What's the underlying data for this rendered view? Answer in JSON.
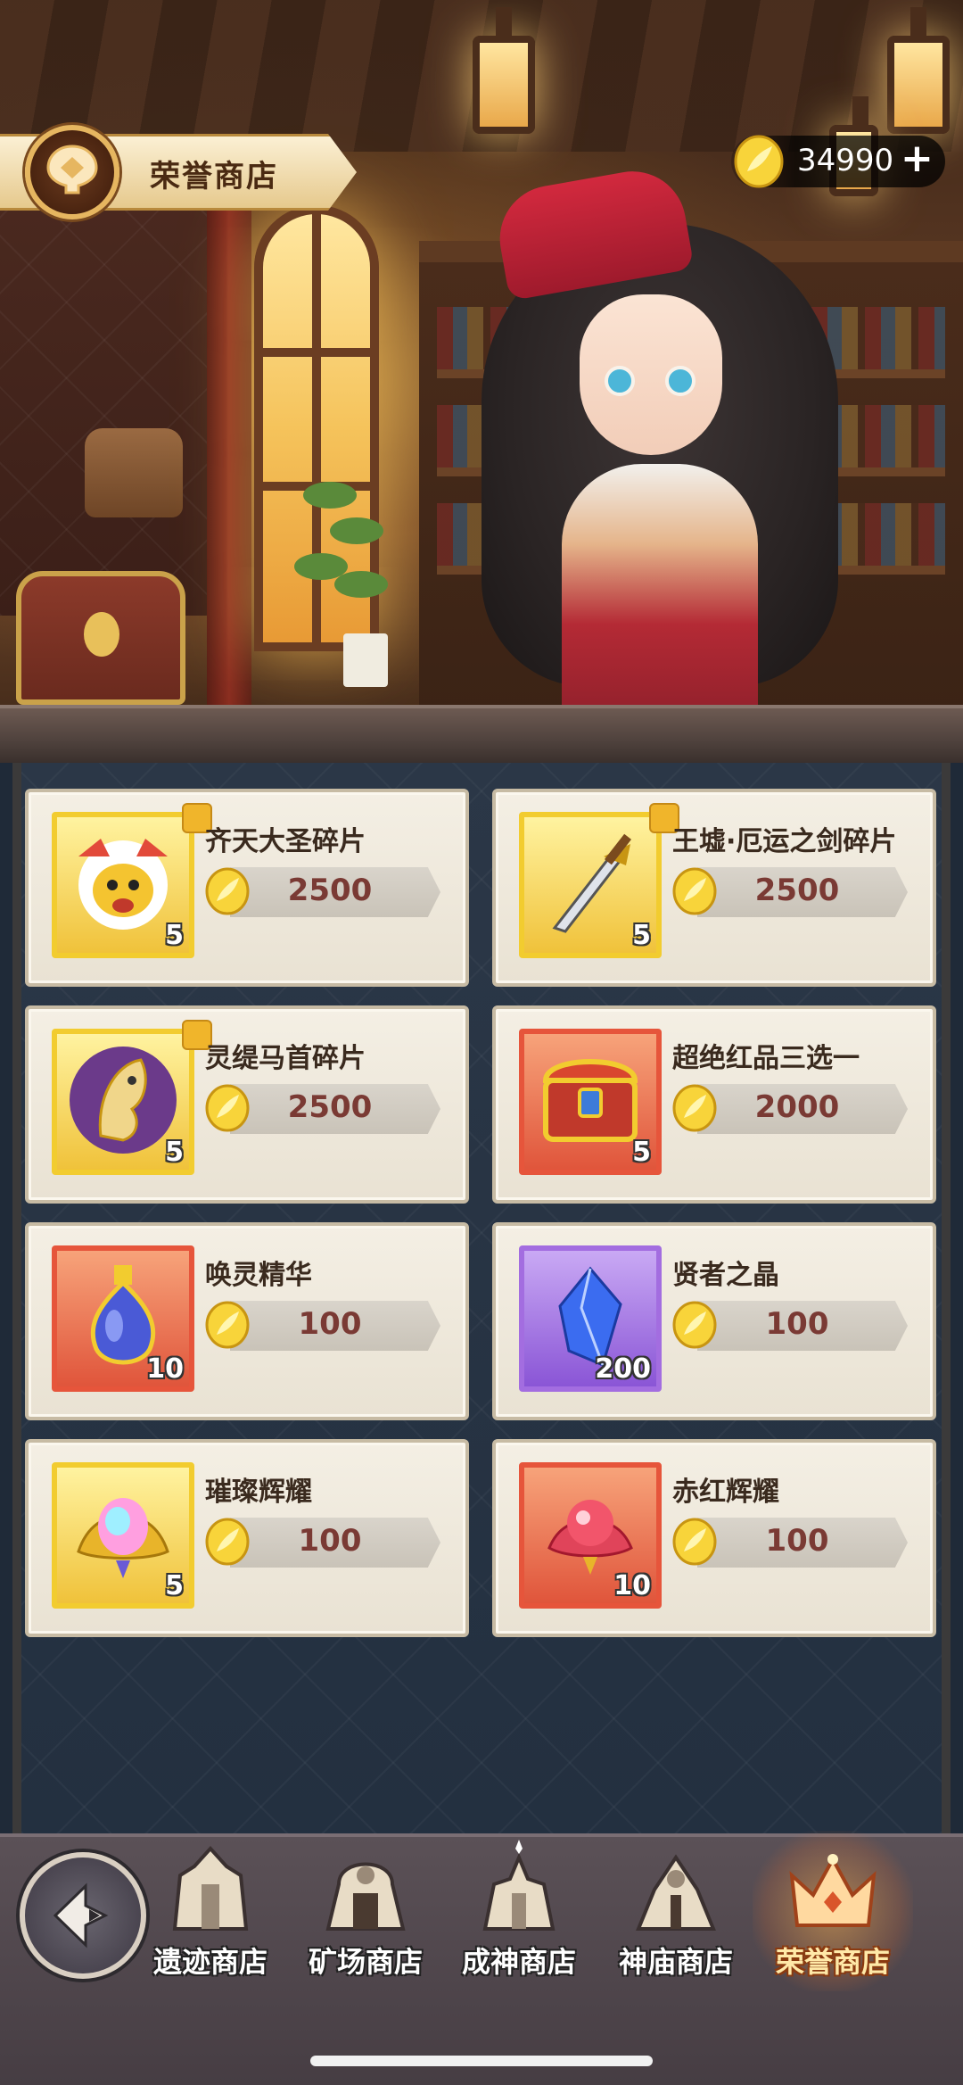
{
  "header": {
    "title": "荣誉商店",
    "currency_amount": "34990",
    "currency_add": "+"
  },
  "items": [
    {
      "name": "齐天大圣碎片",
      "price": "2500",
      "qty": "5",
      "frame": "gold",
      "fragment": true,
      "icon": "monkey-king-icon"
    },
    {
      "name": "王墟·厄运之剑碎片",
      "price": "2500",
      "qty": "5",
      "frame": "gold",
      "fragment": true,
      "icon": "sword-icon"
    },
    {
      "name": "灵缇马首碎片",
      "price": "2500",
      "qty": "5",
      "frame": "gold",
      "fragment": true,
      "icon": "horse-head-icon"
    },
    {
      "name": "超绝红品三选一",
      "price": "2000",
      "qty": "5",
      "frame": "red",
      "fragment": false,
      "icon": "red-chest-icon"
    },
    {
      "name": "唤灵精华",
      "price": "100",
      "qty": "10",
      "frame": "red",
      "fragment": false,
      "icon": "potion-icon"
    },
    {
      "name": "贤者之晶",
      "price": "100",
      "qty": "200",
      "frame": "purple",
      "fragment": false,
      "icon": "blue-crystal-icon"
    },
    {
      "name": "璀璨辉耀",
      "price": "100",
      "qty": "5",
      "frame": "gold",
      "fragment": false,
      "icon": "rainbow-gem-icon"
    },
    {
      "name": "赤红辉耀",
      "price": "100",
      "qty": "10",
      "frame": "red",
      "fragment": false,
      "icon": "red-gem-icon"
    }
  ],
  "nav": {
    "back_icon": "back-arrow-icon",
    "tabs": [
      {
        "label": "遗迹商店",
        "icon": "ruins-icon",
        "active": false
      },
      {
        "label": "矿场商店",
        "icon": "mine-icon",
        "active": false
      },
      {
        "label": "成神商店",
        "icon": "ascension-icon",
        "active": false
      },
      {
        "label": "神庙商店",
        "icon": "temple-icon",
        "active": false
      },
      {
        "label": "荣誉商店",
        "icon": "crown-icon",
        "active": true
      }
    ]
  },
  "colors": {
    "gold_frame": "#f2cc2f",
    "red_frame": "#e6553b",
    "purple_frame": "#a36de0",
    "price_text": "#7a3a34",
    "active_tab": "#ffe9a8"
  }
}
